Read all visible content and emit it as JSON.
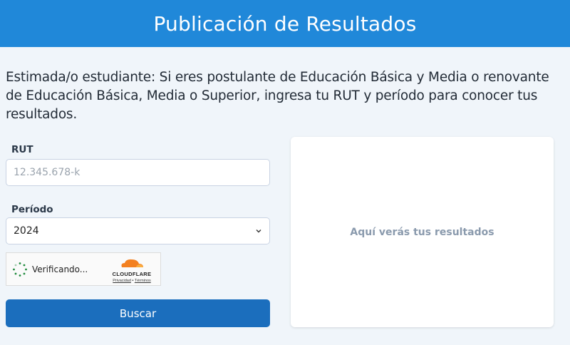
{
  "header": {
    "title": "Publicación de Resultados"
  },
  "intro": {
    "text": "Estimada/o estudiante: Si eres postulante de Educación Básica y Media o renovante de Educación Básica, Media o Superior, ingresa tu RUT y período para conocer tus resultados."
  },
  "form": {
    "rut_label": "RUT",
    "rut_placeholder": "12.345.678-k",
    "rut_value": "",
    "period_label": "Período",
    "period_selected": "2024",
    "search_button": "Buscar"
  },
  "captcha": {
    "status": "Verificando...",
    "brand": "CLOUDFLARE",
    "privacy_link": "Privacidad",
    "separator": "•",
    "terms_link": "Términos"
  },
  "results": {
    "placeholder": "Aquí verás tus resultados"
  },
  "colors": {
    "header": "#2088d9",
    "button": "#1b6ebd",
    "background": "#f0f5fa",
    "cloudflare_orange": "#f38020"
  },
  "icons": {
    "select_chevron": "chevron-down-icon",
    "spinner": "spinner-icon",
    "cloud": "cloudflare-cloud-icon"
  }
}
